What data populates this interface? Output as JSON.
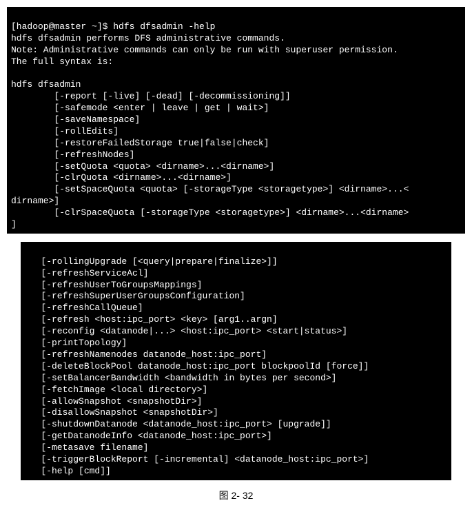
{
  "terminal1": {
    "prompt": "[hadoop@master ~]$ ",
    "command": "hdfs dfsadmin -help",
    "line1": "hdfs dfsadmin performs DFS administrative commands.",
    "line2": "Note: Administrative commands can only be run with superuser permission.",
    "line3": "The full syntax is:",
    "line4": "",
    "line5": "hdfs dfsadmin",
    "opt1": "        [-report [-live] [-dead] [-decommissioning]]",
    "opt2": "        [-safemode <enter | leave | get | wait>]",
    "opt3": "        [-saveNamespace]",
    "opt4": "        [-rollEdits]",
    "opt5": "        [-restoreFailedStorage true|false|check]",
    "opt6": "        [-refreshNodes]",
    "opt7": "        [-setQuota <quota> <dirname>...<dirname>]",
    "opt8": "        [-clrQuota <dirname>...<dirname>]",
    "opt9": "        [-setSpaceQuota <quota> [-storageType <storagetype>] <dirname>...<",
    "opt9b": "dirname>]",
    "opt10": "        [-clrSpaceQuota [-storageType <storagetype>] <dirname>...<dirname>",
    "opt10b": "]"
  },
  "terminal2": {
    "opt1": "   [-rollingUpgrade [<query|prepare|finalize>]]",
    "opt2": "   [-refreshServiceAcl]",
    "opt3": "   [-refreshUserToGroupsMappings]",
    "opt4": "   [-refreshSuperUserGroupsConfiguration]",
    "opt5": "   [-refreshCallQueue]",
    "opt6": "   [-refresh <host:ipc_port> <key> [arg1..argn]",
    "opt7": "   [-reconfig <datanode|...> <host:ipc_port> <start|status>]",
    "opt8": "   [-printTopology]",
    "opt9": "   [-refreshNamenodes datanode_host:ipc_port]",
    "opt10": "   [-deleteBlockPool datanode_host:ipc_port blockpoolId [force]]",
    "opt11": "   [-setBalancerBandwidth <bandwidth in bytes per second>]",
    "opt12": "   [-fetchImage <local directory>]",
    "opt13": "   [-allowSnapshot <snapshotDir>]",
    "opt14": "   [-disallowSnapshot <snapshotDir>]",
    "opt15": "   [-shutdownDatanode <datanode_host:ipc_port> [upgrade]]",
    "opt16": "   [-getDatanodeInfo <datanode_host:ipc_port>]",
    "opt17": "   [-metasave filename]",
    "opt18": "   [-triggerBlockReport [-incremental] <datanode_host:ipc_port>]",
    "opt19": "   [-help [cmd]]"
  },
  "caption": "图 2- 32"
}
